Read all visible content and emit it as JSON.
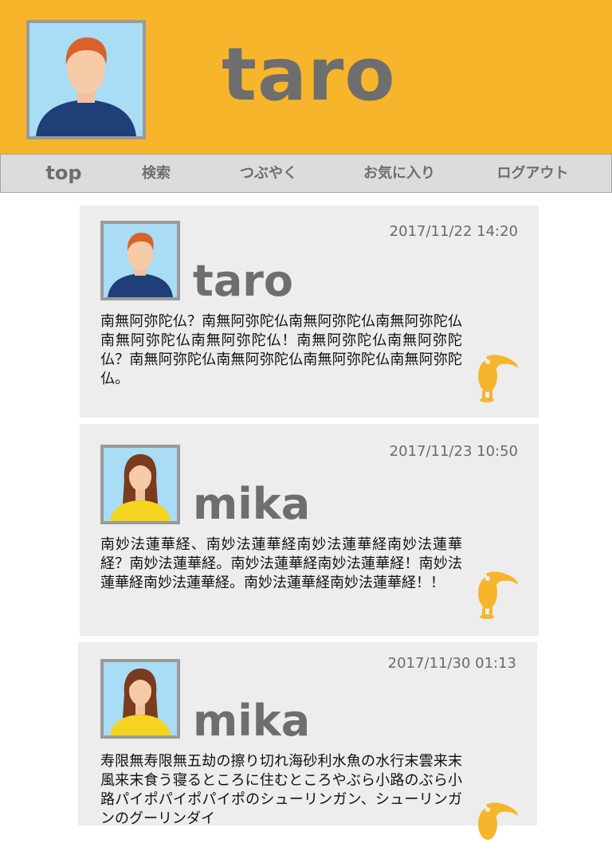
{
  "header": {
    "title": "taro",
    "avatar_icon": "male-avatar-icon"
  },
  "nav": {
    "items": [
      "top",
      "検索",
      "つぶやく",
      "お気に入り",
      "ログアウト"
    ]
  },
  "posts": [
    {
      "name": "taro",
      "date": "2017/11/22 14:20",
      "avatar": "male",
      "body": "南無阿弥陀仏？南無阿弥陀仏南無阿弥陀仏南無阿弥陀仏南無阿弥陀仏南無阿弥陀仏！南無阿弥陀仏南無阿弥陀仏？南無阿弥陀仏南無阿弥陀仏南無阿弥陀仏南無阿弥陀仏。"
    },
    {
      "name": "mika",
      "date": "2017/11/23 10:50",
      "avatar": "female",
      "body": "南妙法蓮華経、南妙法蓮華経南妙法蓮華経南妙法蓮華経？南妙法蓮華経。南妙法蓮華経南妙法蓮華経！南妙法蓮華経南妙法蓮華経。南妙法蓮華経南妙法蓮華経！！"
    },
    {
      "name": "mika",
      "date": "2017/11/30 01:13",
      "avatar": "female",
      "body": "寿限無寿限無五劫の擦り切れ海砂利水魚の水行末雲来末風来末食う寝るところに住むところやぶら小路のぶら小路パイポパイポパイポのシューリンガン、シューリンガンのグーリンダイ"
    }
  ],
  "colors": {
    "accent": "#f7b52c",
    "text_gray": "#6e6e6e",
    "card_bg": "#ededed",
    "nav_bg": "#dcdcdc"
  },
  "icons": {
    "favorite": "toucan-icon"
  }
}
